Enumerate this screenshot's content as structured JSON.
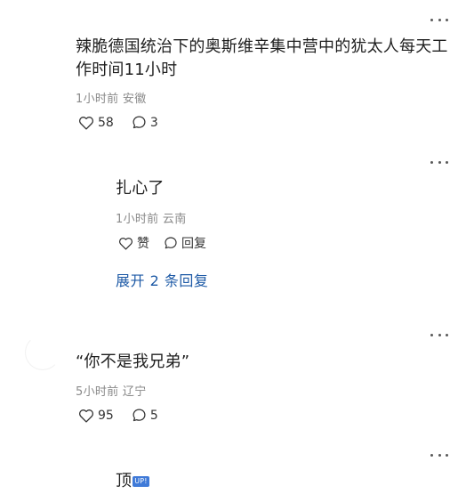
{
  "comments": [
    {
      "text": "辣脆德国统治下的奥斯维辛集中营中的犹太人每天工作时间11小时",
      "meta": "1小时前 安徽",
      "likes": "58",
      "replies": "3"
    },
    {
      "text": "扎心了",
      "meta": "1小时前 云南",
      "like_label": "赞",
      "reply_label": "回复",
      "expand_label": "展开 2 条回复"
    },
    {
      "text": "“你不是我兄弟”",
      "meta": "5小时前 辽宁",
      "likes": "95",
      "replies": "5"
    },
    {
      "text": "顶",
      "badge": "UP!"
    }
  ],
  "icons": [
    "more-icon",
    "heart-icon",
    "comment-icon"
  ],
  "colors": {
    "text": "#1f1f1f",
    "meta": "#8a8a8a",
    "link": "#1e5aa6",
    "badge": "#3f7ad8"
  }
}
